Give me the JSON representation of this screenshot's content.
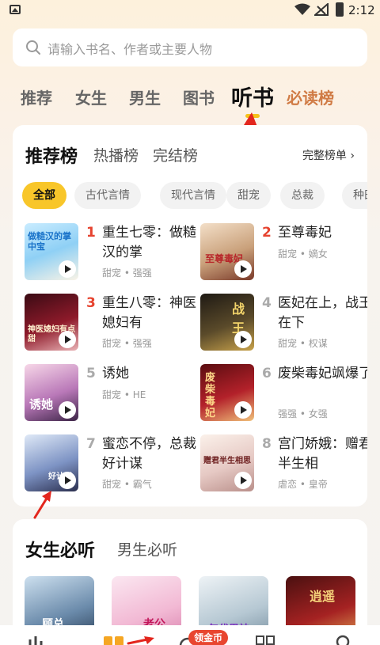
{
  "status_bar": {
    "time": "2:12"
  },
  "search": {
    "placeholder": "请输入书名、作者或主要人物"
  },
  "top_tabs": [
    "推荐",
    "女生",
    "男生",
    "图书",
    "听书",
    "必读榜"
  ],
  "active_top_tab": "听书",
  "ranking": {
    "tabs": [
      "推荐榜",
      "热播榜",
      "完结榜"
    ],
    "active_tab": "推荐榜",
    "full_list_label": "完整榜单 ›",
    "chips": [
      "全部",
      "古代言情",
      "现代言情",
      "甜宠",
      "总裁",
      "种田"
    ],
    "active_chip": "全部",
    "books": [
      {
        "rank": "1",
        "title": "重生七零：做糙汉的掌",
        "tags": "甜宠 • 强强",
        "cover_text": "做糙汉的掌中宝"
      },
      {
        "rank": "2",
        "title": "至尊毒妃",
        "tags": "甜宠 • 嫡女",
        "cover_text": "至尊毒妃"
      },
      {
        "rank": "3",
        "title": "重生八零：神医媳妇有",
        "tags": "甜宠 • 强强",
        "cover_text": "神医媳妇有点甜"
      },
      {
        "rank": "4",
        "title": "医妃在上，战王在下",
        "tags": "甜宠 • 权谋",
        "cover_text": "战王"
      },
      {
        "rank": "5",
        "title": "诱她",
        "tags": "甜宠 • HE",
        "cover_text": "诱她"
      },
      {
        "rank": "6",
        "title": "废柴毒妃飒爆了",
        "tags": "强强 • 女强",
        "cover_text": "废柴毒妃"
      },
      {
        "rank": "7",
        "title": "蜜恋不停，总裁好计谋",
        "tags": "甜宠 • 霸气",
        "cover_text": "好计谋"
      },
      {
        "rank": "8",
        "title": "宫门娇娥：赠君半生相",
        "tags": "虐恋 • 皇帝",
        "cover_text": "赠君半生相思"
      }
    ]
  },
  "must_listen": {
    "tabs": [
      "女生必听",
      "男生必听"
    ],
    "active_tab": "女生必听",
    "covers": [
      "顾总",
      "老公",
      "年代男神",
      "逍遥"
    ]
  },
  "bottom_nav": {
    "coin_badge": "领金币"
  },
  "colors": {
    "accent_yellow": "#f8c62a",
    "rank_red": "#e6432f",
    "special_tab": "#d07b45",
    "badge_red": "#e8462f"
  }
}
